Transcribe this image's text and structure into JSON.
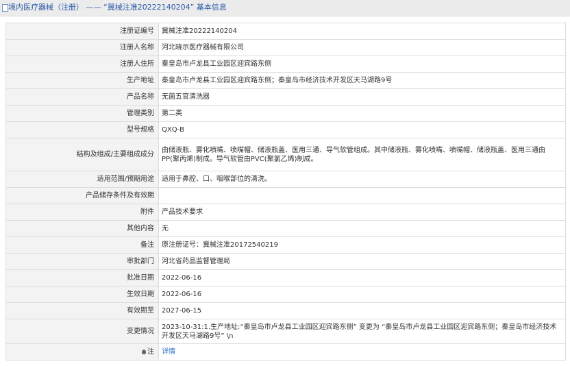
{
  "breadcrumb": {
    "text": "境内医疗器械（注册） —— “冀械注准20222140204” 基本信息"
  },
  "rows": [
    {
      "label": "注册证编号",
      "value": "冀械注准20222140204"
    },
    {
      "label": "注册人名称",
      "value": "河北晓示医疗器械有限公司"
    },
    {
      "label": "注册人住所",
      "value": "秦皇岛市卢龙县工业园区迎宾路东侧"
    },
    {
      "label": "生产地址",
      "value": "秦皇岛市卢龙县工业园区迎宾路东侧；秦皇岛市经济技术开发区天马湖路9号"
    },
    {
      "label": "产品名称",
      "value": "无菌五官清洗器"
    },
    {
      "label": "管理类别",
      "value": "第二类"
    },
    {
      "label": "型号规格",
      "value": "QXQ-B"
    },
    {
      "label": "结构及组成/主要组成成分",
      "value": "由储液瓶、雾化喷嘴、喷嘴帽、储液瓶盖、医用三通、导气软管组成。其中储液瓶、雾化喷嘴、喷嘴帽、储液瓶盖、医用三通由PP(聚丙烯)制成。导气软管由PVC(聚氯乙烯)制成。"
    },
    {
      "label": "适用范围/预期用途",
      "value": "适用于鼻腔、口、咽喉部位的清洗。"
    },
    {
      "label": "产品储存条件及有效期",
      "value": ""
    },
    {
      "label": "附件",
      "value": "产品技术要求"
    },
    {
      "label": "其他内容",
      "value": "无"
    },
    {
      "label": "备注",
      "value": "原注册证号：冀械注准20172540219"
    },
    {
      "label": "审批部门",
      "value": "河北省药品监督管理局"
    },
    {
      "label": "批准日期",
      "value": "2022-06-16"
    },
    {
      "label": "生效日期",
      "value": "2022-06-16"
    },
    {
      "label": "有效期至",
      "value": "2027-06-15"
    },
    {
      "label": "变更情况",
      "value": "2023-10-31:1.生产地址:“秦皇岛市卢龙县工业园区迎宾路东侧” 变更为 “秦皇岛市卢龙县工业园区迎宾路东侧；秦皇岛市经济技术开发区天马湖路9号” \\n"
    }
  ],
  "note": {
    "label": "注",
    "link": "详情",
    "icon": "lightbulb-icon"
  }
}
